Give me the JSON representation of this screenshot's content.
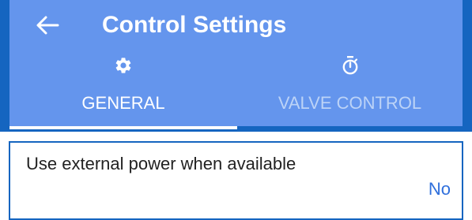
{
  "header": {
    "title": "Control Settings",
    "back_icon": "arrow-left-icon"
  },
  "tabs": [
    {
      "label": "GENERAL",
      "icon": "gear-icon",
      "selected": true
    },
    {
      "label": "VALVE CONTROL",
      "icon": "stopwatch-icon",
      "selected": false
    }
  ],
  "settings": [
    {
      "label": "Use external power when available",
      "value": "No"
    }
  ],
  "colors": {
    "appbar_dark": "#1565c0",
    "appbar_light": "#6495ed",
    "accent": "#2f6fdc",
    "tab_inactive": "#bcd3f7"
  }
}
